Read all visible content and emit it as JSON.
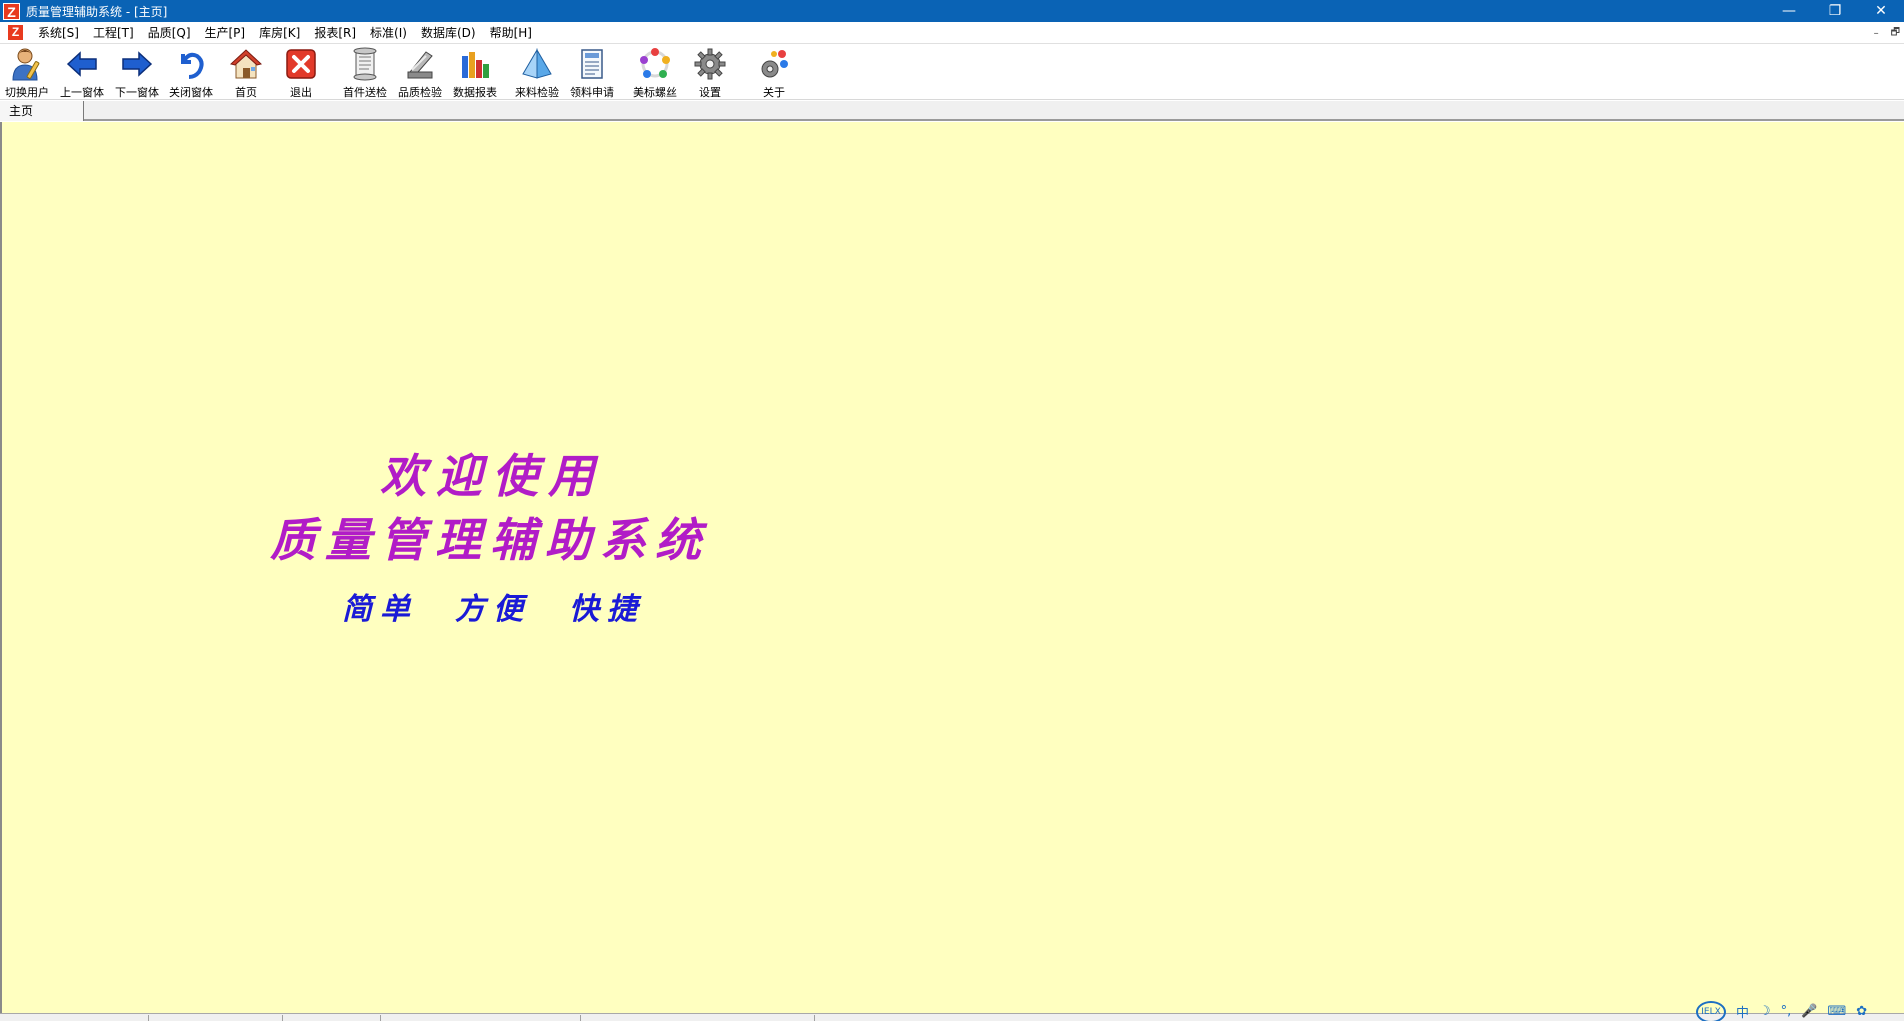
{
  "window": {
    "title": "质量管理辅助系统 - [主页]",
    "logo_letter": "Z",
    "minimize": "—",
    "restore": "❐",
    "close": "✕"
  },
  "menu": {
    "items": [
      "系统[S]",
      "工程[T]",
      "品质[Q]",
      "生产[P]",
      "库房[K]",
      "报表[R]",
      "标准(I)",
      "数据库(D)",
      "帮助[H]"
    ],
    "mdi_minimize": "–",
    "mdi_restore": "🗗"
  },
  "toolbar": {
    "buttons": [
      {
        "label": "切换用户",
        "icon": "user-switch-icon"
      },
      {
        "label": "上一窗体",
        "icon": "arrow-left-icon"
      },
      {
        "label": "下一窗体",
        "icon": "arrow-right-icon"
      },
      {
        "label": "关闭窗体",
        "icon": "undo-icon"
      },
      {
        "label": "首页",
        "icon": "home-icon"
      },
      {
        "label": "退出",
        "icon": "exit-icon"
      },
      {
        "label": "首件送检",
        "icon": "scroll-icon"
      },
      {
        "label": "品质检验",
        "icon": "scanner-icon"
      },
      {
        "label": "数据报表",
        "icon": "bar-chart-icon"
      },
      {
        "label": "来料检验",
        "icon": "pyramid-icon"
      },
      {
        "label": "领料申请",
        "icon": "document-icon"
      },
      {
        "label": "美标螺丝",
        "icon": "cycle-icon"
      },
      {
        "label": "设置",
        "icon": "gear-icon"
      },
      {
        "label": "关于",
        "icon": "about-icon"
      }
    ]
  },
  "tabs": [
    {
      "label": "主页"
    }
  ],
  "main": {
    "welcome_line1": "欢迎使用",
    "welcome_line2": "质量管理辅助系统",
    "slogans": [
      "简单",
      "方便",
      "快捷"
    ]
  },
  "ime": {
    "mode": "中",
    "badge": "IELX"
  },
  "colors": {
    "titlebar": "#0a63b5",
    "main_bg": "#ffffc0",
    "welcome": "#b11cc7",
    "slogan": "#1a1ad6"
  }
}
